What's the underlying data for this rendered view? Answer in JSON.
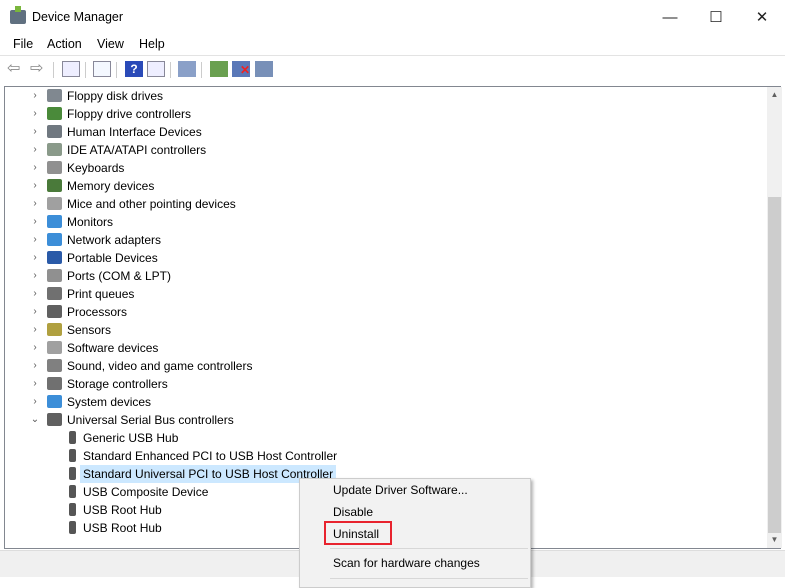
{
  "window": {
    "title": "Device Manager",
    "minimize": "—",
    "maximize": "☐",
    "close": "✕"
  },
  "menu": [
    "File",
    "Action",
    "View",
    "Help"
  ],
  "toolbar_icons": [
    "back-icon",
    "forward-icon",
    "show-hide-tree-icon",
    "properties-icon",
    "help-icon",
    "action-pane-icon",
    "scan-hardware-icon",
    "update-driver-icon",
    "uninstall-device-icon",
    "disable-device-icon"
  ],
  "tree": {
    "categories": [
      {
        "label": "Floppy disk drives",
        "color": "#808890"
      },
      {
        "label": "Floppy drive controllers",
        "color": "#4a8a3a"
      },
      {
        "label": "Human Interface Devices",
        "color": "#707880"
      },
      {
        "label": "IDE ATA/ATAPI controllers",
        "color": "#8a9a8a"
      },
      {
        "label": "Keyboards",
        "color": "#909090"
      },
      {
        "label": "Memory devices",
        "color": "#4a7a3a"
      },
      {
        "label": "Mice and other pointing devices",
        "color": "#a0a0a0"
      },
      {
        "label": "Monitors",
        "color": "#3c8ed8"
      },
      {
        "label": "Network adapters",
        "color": "#3c8ed8"
      },
      {
        "label": "Portable Devices",
        "color": "#2a5aa8"
      },
      {
        "label": "Ports (COM & LPT)",
        "color": "#909090"
      },
      {
        "label": "Print queues",
        "color": "#707070"
      },
      {
        "label": "Processors",
        "color": "#606060"
      },
      {
        "label": "Sensors",
        "color": "#b0a040"
      },
      {
        "label": "Software devices",
        "color": "#a0a0a0"
      },
      {
        "label": "Sound, video and game controllers",
        "color": "#808080"
      },
      {
        "label": "Storage controllers",
        "color": "#707070"
      },
      {
        "label": "System devices",
        "color": "#3c8ed8"
      },
      {
        "label": "Universal Serial Bus controllers",
        "color": "#606060"
      }
    ],
    "usb_children": [
      "Generic USB Hub",
      "Standard Enhanced PCI to USB Host Controller",
      "Standard Universal PCI to USB Host Controller",
      "USB Composite Device",
      "USB Root Hub",
      "USB Root Hub"
    ],
    "selected_child": 2
  },
  "context_menu": {
    "items": [
      "Update Driver Software...",
      "Disable",
      "Uninstall",
      "Scan for hardware changes"
    ],
    "highlighted": "Uninstall",
    "highlight_color": "#e8232e"
  }
}
